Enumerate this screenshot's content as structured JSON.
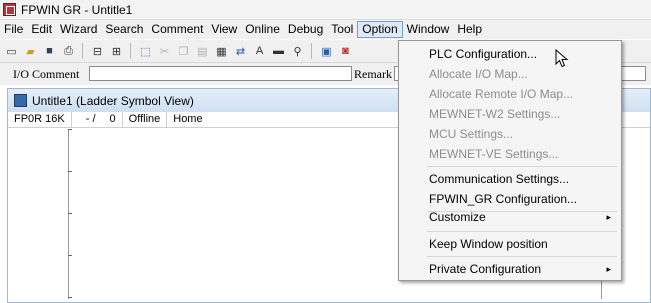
{
  "window": {
    "title": "FPWIN GR - Untitle1"
  },
  "menubar": [
    {
      "label": "File"
    },
    {
      "label": "Edit"
    },
    {
      "label": "Wizard"
    },
    {
      "label": "Search"
    },
    {
      "label": "Comment"
    },
    {
      "label": "View"
    },
    {
      "label": "Online"
    },
    {
      "label": "Debug"
    },
    {
      "label": "Tool"
    },
    {
      "label": "Option"
    },
    {
      "label": "Window"
    },
    {
      "label": "Help"
    }
  ],
  "toolbar_icons": [
    "new-icon",
    "open-icon",
    "save-icon",
    "print-icon",
    "monitor-icon",
    "monitor2-icon",
    "select-icon",
    "cut-icon",
    "copy-icon",
    "paste-icon",
    "block-icon",
    "transfer-icon",
    "text-icon",
    "bar-icon",
    "find-icon",
    "module-icon",
    "breakpoint-icon"
  ],
  "comment_bar": {
    "io_label": "I/O Comment",
    "io_value": "",
    "remark_label": "Remark",
    "remark_value": ""
  },
  "child_window": {
    "title": "Untitle1 (Ladder Symbol View)",
    "status": {
      "plc": "FP0R 16K",
      "step": "- /",
      "count": "0",
      "mode": "Offline",
      "location": "Home"
    }
  },
  "option_menu": {
    "items": [
      {
        "label": "PLC Configuration...",
        "enabled": true
      },
      {
        "label": "Allocate I/O Map...",
        "enabled": false
      },
      {
        "label": "Allocate Remote I/O Map...",
        "enabled": false
      },
      {
        "label": "MEWNET-W2 Settings...",
        "enabled": false
      },
      {
        "label": "MCU Settings...",
        "enabled": false
      },
      {
        "label": "MEWNET-VE Settings...",
        "enabled": false
      },
      {
        "label": "Communication Settings...",
        "enabled": true
      },
      {
        "label": "FPWIN_GR Configuration...",
        "enabled": true
      },
      {
        "label": "Customize",
        "enabled": true,
        "submenu": true
      },
      {
        "label": "Keep Window position",
        "enabled": true
      },
      {
        "label": "Private Configuration",
        "enabled": true,
        "submenu": true
      }
    ],
    "submenu_arrow": "▸"
  },
  "colors": {
    "menu_highlight": "#dfe9f5",
    "disabled_text": "#8d8d8d"
  }
}
